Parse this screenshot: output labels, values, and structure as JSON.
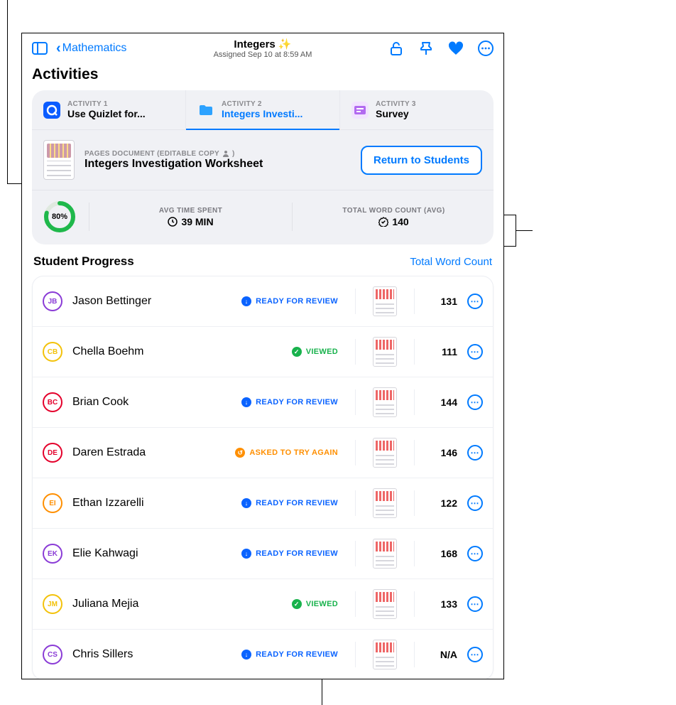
{
  "header": {
    "back_label": "Mathematics",
    "title": "Integers ✨",
    "subtitle": "Assigned Sep 10 at 8:59 AM"
  },
  "activities_title": "Activities",
  "tabs": [
    {
      "eyebrow": "ACTIVITY 1",
      "label": "Use Quizlet for..."
    },
    {
      "eyebrow": "ACTIVITY 2",
      "label": "Integers Investi..."
    },
    {
      "eyebrow": "ACTIVITY 3",
      "label": "Survey"
    }
  ],
  "document": {
    "eyebrow": "PAGES DOCUMENT (EDITABLE COPY",
    "eyebrow_suffix": ")",
    "title": "Integers Investigation Worksheet",
    "return_label": "Return to Students"
  },
  "stats": {
    "progress_pct": "80%",
    "time_label": "AVG TIME SPENT",
    "time_value": "39 MIN",
    "words_label": "TOTAL WORD COUNT (AVG)",
    "words_value": "140"
  },
  "progress": {
    "title": "Student Progress",
    "sort_label": "Total Word Count"
  },
  "status_labels": {
    "review": "READY FOR REVIEW",
    "viewed": "VIEWED",
    "try": "ASKED TO TRY AGAIN"
  },
  "students": [
    {
      "initials": "JB",
      "color": "#8a3bd6",
      "name": "Jason Bettinger",
      "status": "review",
      "count": "131"
    },
    {
      "initials": "CB",
      "color": "#f3c20b",
      "name": "Chella Boehm",
      "status": "viewed",
      "count": "111"
    },
    {
      "initials": "BC",
      "color": "#e4002b",
      "name": "Brian Cook",
      "status": "review",
      "count": "144"
    },
    {
      "initials": "DE",
      "color": "#e4002b",
      "name": "Daren Estrada",
      "status": "try",
      "count": "146"
    },
    {
      "initials": "EI",
      "color": "#ff8f00",
      "name": "Ethan Izzarelli",
      "status": "review",
      "count": "122"
    },
    {
      "initials": "EK",
      "color": "#8a3bd6",
      "name": "Elie Kahwagi",
      "status": "review",
      "count": "168"
    },
    {
      "initials": "JM",
      "color": "#f3c20b",
      "name": "Juliana Mejia",
      "status": "viewed",
      "count": "133"
    },
    {
      "initials": "CS",
      "color": "#8a3bd6",
      "name": "Chris Sillers",
      "status": "review",
      "count": "N/A"
    }
  ]
}
